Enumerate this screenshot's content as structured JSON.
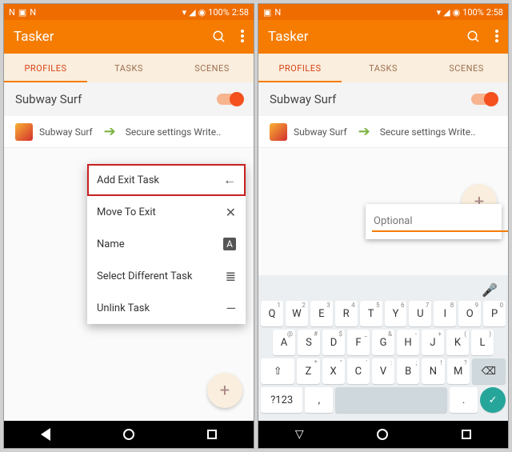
{
  "status": {
    "battery": "100%",
    "time": "2:58"
  },
  "app": {
    "title": "Tasker"
  },
  "tabs": [
    "PROFILES",
    "TASKS",
    "SCENES"
  ],
  "profile": {
    "name": "Subway Surf",
    "task_app": "Subway Surf",
    "task_action": "Secure settings Write.."
  },
  "menu": {
    "items": [
      {
        "label": "Add Exit Task",
        "icon": "←"
      },
      {
        "label": "Move To Exit",
        "icon": "✕"
      },
      {
        "label": "Name",
        "icon": "A"
      },
      {
        "label": "Select Different Task",
        "icon": "≣"
      },
      {
        "label": "Unlink Task",
        "icon": "—"
      }
    ]
  },
  "input": {
    "placeholder": "Optional"
  },
  "keyboard": {
    "row1": [
      {
        "k": "Q",
        "s": "1"
      },
      {
        "k": "W",
        "s": "2"
      },
      {
        "k": "E",
        "s": "3"
      },
      {
        "k": "R",
        "s": "4"
      },
      {
        "k": "T",
        "s": "5"
      },
      {
        "k": "Y",
        "s": "6"
      },
      {
        "k": "U",
        "s": "7"
      },
      {
        "k": "I",
        "s": "8"
      },
      {
        "k": "O",
        "s": "9"
      },
      {
        "k": "P",
        "s": "0"
      }
    ],
    "row2": [
      {
        "k": "A",
        "s": "@"
      },
      {
        "k": "S",
        "s": "#"
      },
      {
        "k": "D",
        "s": "$"
      },
      {
        "k": "F",
        "s": "_"
      },
      {
        "k": "G",
        "s": "&"
      },
      {
        "k": "H",
        "s": "-"
      },
      {
        "k": "J",
        "s": "+"
      },
      {
        "k": "K",
        "s": "("
      },
      {
        "k": "L",
        "s": ")"
      }
    ],
    "row3": [
      {
        "k": "Z",
        "s": "*"
      },
      {
        "k": "X",
        "s": "\""
      },
      {
        "k": "C",
        "s": "'"
      },
      {
        "k": "V",
        "s": ":"
      },
      {
        "k": "B",
        "s": ";"
      },
      {
        "k": "N",
        "s": "!"
      },
      {
        "k": "M",
        "s": "?"
      }
    ],
    "sym": "?123",
    "comma": ",",
    "period": "."
  }
}
